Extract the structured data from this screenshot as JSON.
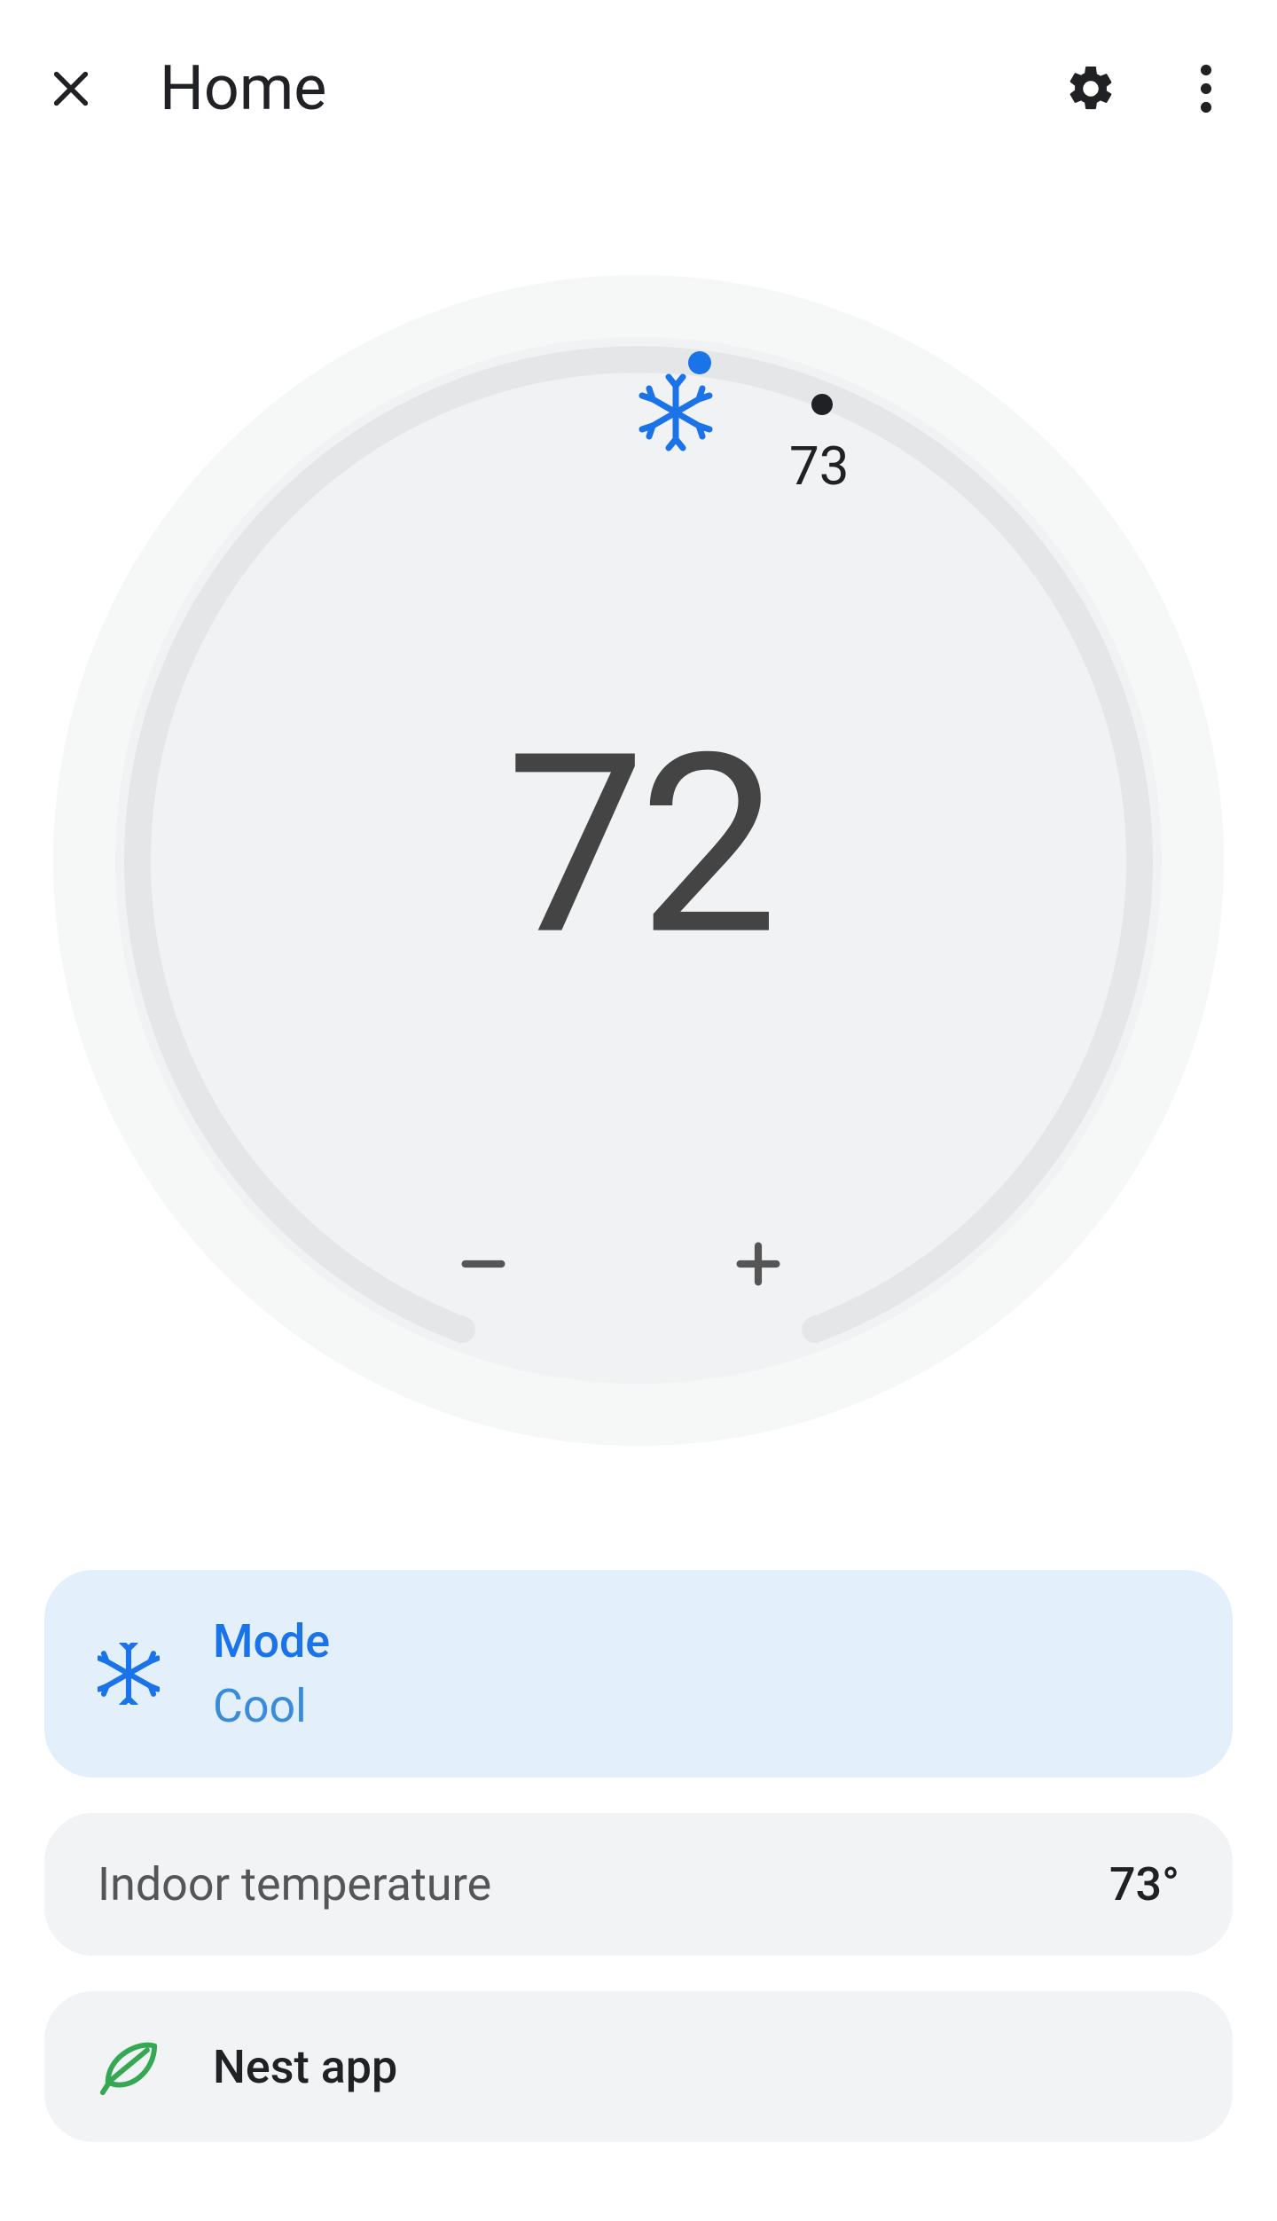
{
  "header": {
    "title": "Home"
  },
  "thermostat": {
    "set_temp": "72",
    "indoor_dial_label": "73"
  },
  "mode_card": {
    "title": "Mode",
    "value": "Cool"
  },
  "indoor_card": {
    "label": "Indoor temperature",
    "value": "73°"
  },
  "nest_card": {
    "label": "Nest app"
  }
}
